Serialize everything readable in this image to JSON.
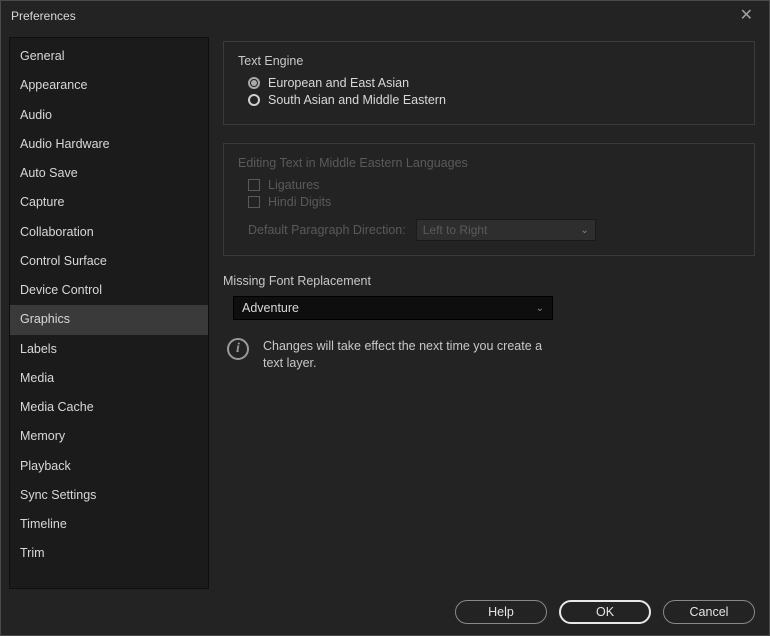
{
  "window": {
    "title": "Preferences"
  },
  "sidebar": {
    "items": [
      {
        "label": "General"
      },
      {
        "label": "Appearance"
      },
      {
        "label": "Audio"
      },
      {
        "label": "Audio Hardware"
      },
      {
        "label": "Auto Save"
      },
      {
        "label": "Capture"
      },
      {
        "label": "Collaboration"
      },
      {
        "label": "Control Surface"
      },
      {
        "label": "Device Control"
      },
      {
        "label": "Graphics"
      },
      {
        "label": "Labels"
      },
      {
        "label": "Media"
      },
      {
        "label": "Media Cache"
      },
      {
        "label": "Memory"
      },
      {
        "label": "Playback"
      },
      {
        "label": "Sync Settings"
      },
      {
        "label": "Timeline"
      },
      {
        "label": "Trim"
      }
    ],
    "selected_index": 9
  },
  "text_engine": {
    "title": "Text Engine",
    "options": [
      {
        "label": "European and East Asian",
        "checked": true
      },
      {
        "label": "South Asian and Middle Eastern",
        "checked": false
      }
    ]
  },
  "middle_eastern": {
    "title": "Editing Text in Middle Eastern Languages",
    "ligatures_label": "Ligatures",
    "hindi_label": "Hindi Digits",
    "direction_label": "Default Paragraph Direction:",
    "direction_value": "Left to Right"
  },
  "font_replacement": {
    "title": "Missing Font Replacement",
    "value": "Adventure"
  },
  "notice": "Changes will take effect the next time you create a text layer.",
  "buttons": {
    "help": "Help",
    "ok": "OK",
    "cancel": "Cancel"
  }
}
